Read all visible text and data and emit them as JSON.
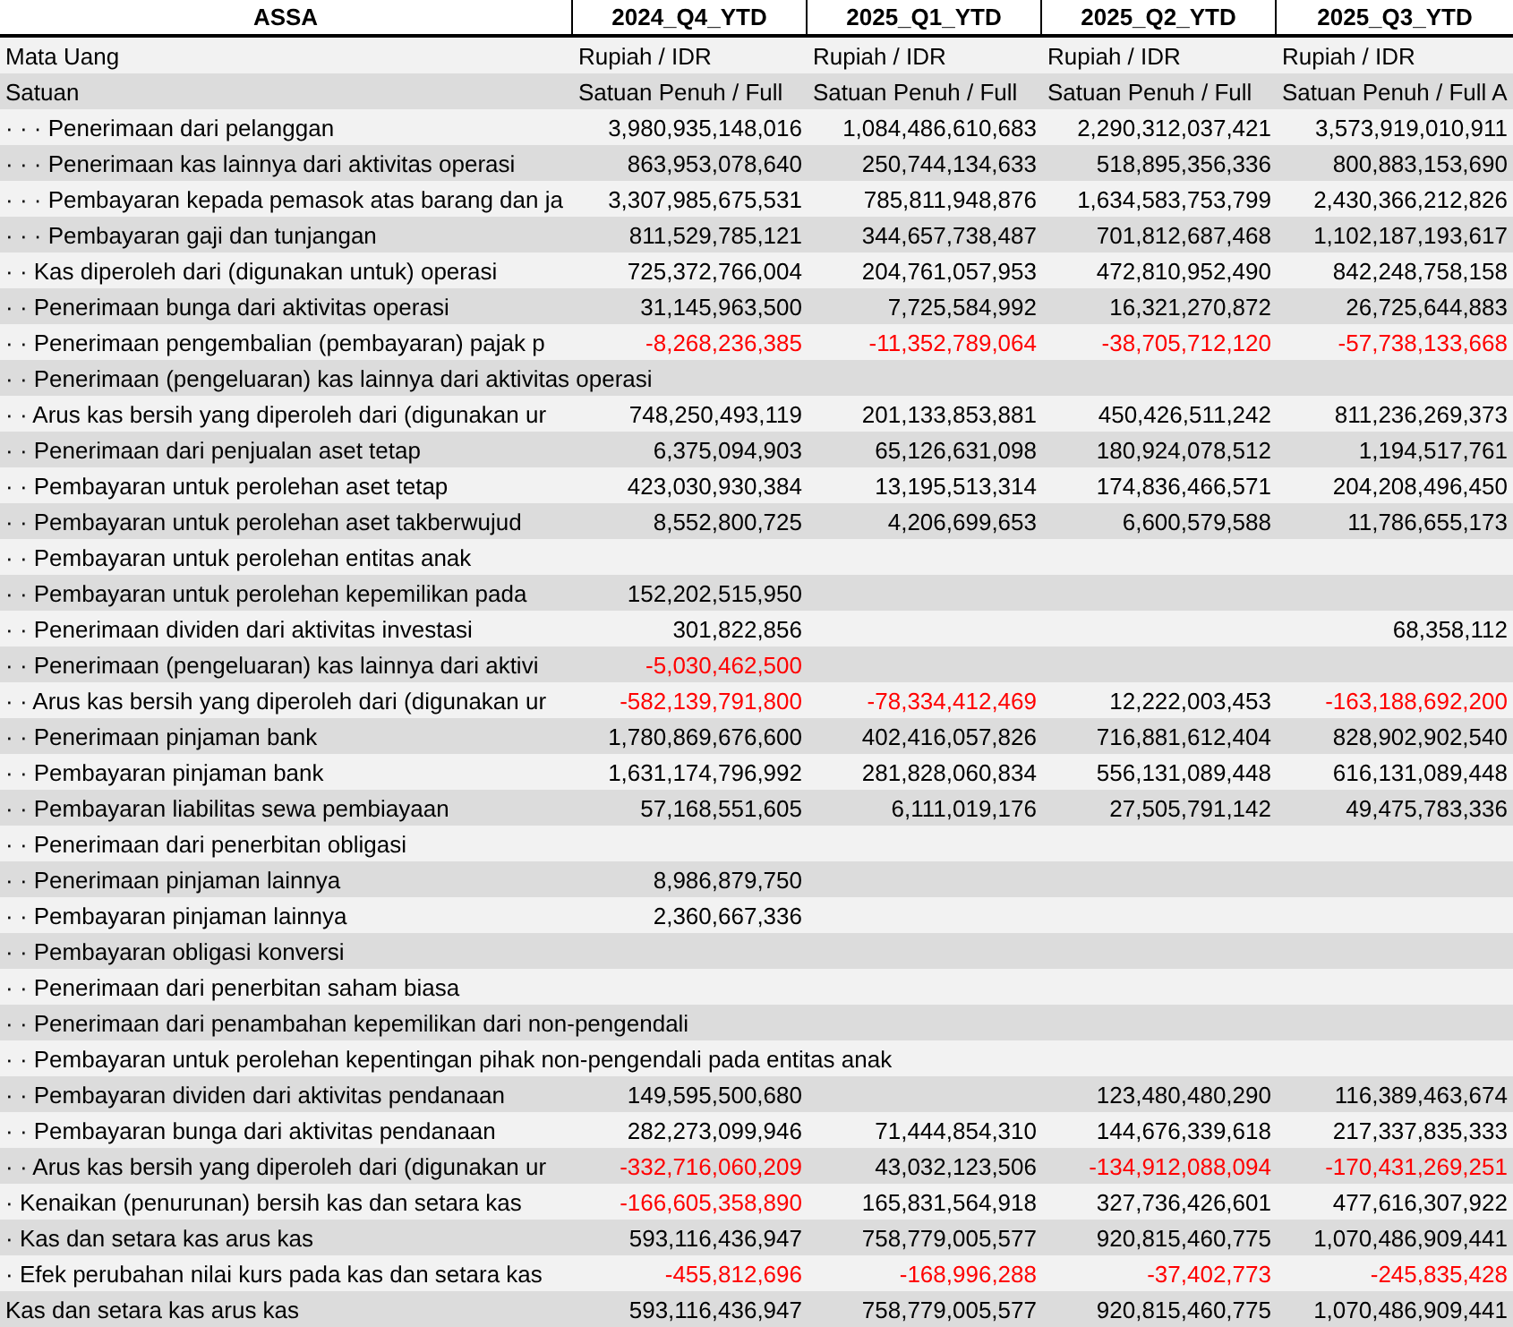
{
  "table": {
    "columns": [
      "ASSA",
      "2024_Q4_YTD",
      "2025_Q1_YTD",
      "2025_Q2_YTD",
      "2025_Q3_YTD"
    ],
    "rows": [
      {
        "kind": "meta",
        "label": "Mata Uang",
        "cells": {
          "q4_2024": {
            "text": "Rupiah / IDR",
            "negative": false
          },
          "q1_2025": {
            "text": "Rupiah / IDR",
            "negative": false
          },
          "q2_2025": {
            "text": "Rupiah / IDR",
            "negative": false
          },
          "q3_2025": {
            "text": "Rupiah / IDR",
            "negative": false
          }
        }
      },
      {
        "kind": "meta",
        "label": "Satuan",
        "cells": {
          "q4_2024": {
            "text": "Satuan Penuh / Full",
            "negative": false
          },
          "q1_2025": {
            "text": "Satuan Penuh / Full",
            "negative": false
          },
          "q2_2025": {
            "text": "Satuan Penuh / Full",
            "negative": false
          },
          "q3_2025": {
            "text": "Satuan Penuh / Full A",
            "negative": false
          }
        }
      },
      {
        "kind": "data",
        "label": "· · · Penerimaan dari pelanggan",
        "cells": {
          "q4_2024": {
            "text": "3,980,935,148,016",
            "negative": false
          },
          "q1_2025": {
            "text": "1,084,486,610,683",
            "negative": false
          },
          "q2_2025": {
            "text": "2,290,312,037,421",
            "negative": false
          },
          "q3_2025": {
            "text": "3,573,919,010,911",
            "negative": false
          }
        }
      },
      {
        "kind": "data",
        "label": "· · · Penerimaan kas lainnya dari aktivitas operasi",
        "cells": {
          "q4_2024": {
            "text": "863,953,078,640",
            "negative": false
          },
          "q1_2025": {
            "text": "250,744,134,633",
            "negative": false
          },
          "q2_2025": {
            "text": "518,895,356,336",
            "negative": false
          },
          "q3_2025": {
            "text": "800,883,153,690",
            "negative": false
          }
        }
      },
      {
        "kind": "data",
        "label": "· · · Pembayaran kepada pemasok atas barang dan ja",
        "cells": {
          "q4_2024": {
            "text": "3,307,985,675,531",
            "negative": false
          },
          "q1_2025": {
            "text": "785,811,948,876",
            "negative": false
          },
          "q2_2025": {
            "text": "1,634,583,753,799",
            "negative": false
          },
          "q3_2025": {
            "text": "2,430,366,212,826",
            "negative": false
          }
        }
      },
      {
        "kind": "data",
        "label": "· · · Pembayaran gaji dan tunjangan",
        "cells": {
          "q4_2024": {
            "text": "811,529,785,121",
            "negative": false
          },
          "q1_2025": {
            "text": "344,657,738,487",
            "negative": false
          },
          "q2_2025": {
            "text": "701,812,687,468",
            "negative": false
          },
          "q3_2025": {
            "text": "1,102,187,193,617",
            "negative": false
          }
        }
      },
      {
        "kind": "data",
        "label": "· · Kas diperoleh dari (digunakan untuk) operasi",
        "cells": {
          "q4_2024": {
            "text": "725,372,766,004",
            "negative": false
          },
          "q1_2025": {
            "text": "204,761,057,953",
            "negative": false
          },
          "q2_2025": {
            "text": "472,810,952,490",
            "negative": false
          },
          "q3_2025": {
            "text": "842,248,758,158",
            "negative": false
          }
        }
      },
      {
        "kind": "data",
        "label": "· · Penerimaan bunga dari aktivitas operasi",
        "cells": {
          "q4_2024": {
            "text": "31,145,963,500",
            "negative": false
          },
          "q1_2025": {
            "text": "7,725,584,992",
            "negative": false
          },
          "q2_2025": {
            "text": "16,321,270,872",
            "negative": false
          },
          "q3_2025": {
            "text": "26,725,644,883",
            "negative": false
          }
        }
      },
      {
        "kind": "data",
        "label": "· · Penerimaan pengembalian (pembayaran) pajak p",
        "cells": {
          "q4_2024": {
            "text": "-8,268,236,385",
            "negative": true
          },
          "q1_2025": {
            "text": "-11,352,789,064",
            "negative": true
          },
          "q2_2025": {
            "text": "-38,705,712,120",
            "negative": true
          },
          "q3_2025": {
            "text": "-57,738,133,668",
            "negative": true
          }
        }
      },
      {
        "kind": "data",
        "label": "· · Penerimaan (pengeluaran) kas lainnya dari aktivitas operasi"
      },
      {
        "kind": "data",
        "label": "· · Arus kas bersih yang diperoleh dari (digunakan ur",
        "cells": {
          "q4_2024": {
            "text": "748,250,493,119",
            "negative": false
          },
          "q1_2025": {
            "text": "201,133,853,881",
            "negative": false
          },
          "q2_2025": {
            "text": "450,426,511,242",
            "negative": false
          },
          "q3_2025": {
            "text": "811,236,269,373",
            "negative": false
          }
        }
      },
      {
        "kind": "data",
        "label": "· · Penerimaan dari penjualan aset tetap",
        "cells": {
          "q4_2024": {
            "text": "6,375,094,903",
            "negative": false
          },
          "q1_2025": {
            "text": "65,126,631,098",
            "negative": false
          },
          "q2_2025": {
            "text": "180,924,078,512",
            "negative": false
          },
          "q3_2025": {
            "text": "1,194,517,761",
            "negative": false
          }
        }
      },
      {
        "kind": "data",
        "label": "· · Pembayaran untuk perolehan aset tetap",
        "cells": {
          "q4_2024": {
            "text": "423,030,930,384",
            "negative": false
          },
          "q1_2025": {
            "text": "13,195,513,314",
            "negative": false
          },
          "q2_2025": {
            "text": "174,836,466,571",
            "negative": false
          },
          "q3_2025": {
            "text": "204,208,496,450",
            "negative": false
          }
        }
      },
      {
        "kind": "data",
        "label": "· · Pembayaran untuk perolehan aset takberwujud",
        "cells": {
          "q4_2024": {
            "text": "8,552,800,725",
            "negative": false
          },
          "q1_2025": {
            "text": "4,206,699,653",
            "negative": false
          },
          "q2_2025": {
            "text": "6,600,579,588",
            "negative": false
          },
          "q3_2025": {
            "text": "11,786,655,173",
            "negative": false
          }
        }
      },
      {
        "kind": "data",
        "label": "· · Pembayaran untuk perolehan entitas anak"
      },
      {
        "kind": "data",
        "label": "· · Pembayaran untuk perolehan kepemilikan pada",
        "cells": {
          "q4_2024": {
            "text": "152,202,515,950",
            "negative": false
          }
        }
      },
      {
        "kind": "data",
        "label": "· · Penerimaan dividen dari aktivitas investasi",
        "cells": {
          "q4_2024": {
            "text": "301,822,856",
            "negative": false
          },
          "q3_2025": {
            "text": "68,358,112",
            "negative": false
          }
        }
      },
      {
        "kind": "data",
        "label": "· · Penerimaan (pengeluaran) kas lainnya dari aktivi",
        "cells": {
          "q4_2024": {
            "text": "-5,030,462,500",
            "negative": true
          }
        }
      },
      {
        "kind": "data",
        "label": "· · Arus kas bersih yang diperoleh dari (digunakan ur",
        "cells": {
          "q4_2024": {
            "text": "-582,139,791,800",
            "negative": true
          },
          "q1_2025": {
            "text": "-78,334,412,469",
            "negative": true
          },
          "q2_2025": {
            "text": "12,222,003,453",
            "negative": false
          },
          "q3_2025": {
            "text": "-163,188,692,200",
            "negative": true
          }
        }
      },
      {
        "kind": "data",
        "label": "· · Penerimaan pinjaman bank",
        "cells": {
          "q4_2024": {
            "text": "1,780,869,676,600",
            "negative": false
          },
          "q1_2025": {
            "text": "402,416,057,826",
            "negative": false
          },
          "q2_2025": {
            "text": "716,881,612,404",
            "negative": false
          },
          "q3_2025": {
            "text": "828,902,902,540",
            "negative": false
          }
        }
      },
      {
        "kind": "data",
        "label": "· · Pembayaran pinjaman bank",
        "cells": {
          "q4_2024": {
            "text": "1,631,174,796,992",
            "negative": false
          },
          "q1_2025": {
            "text": "281,828,060,834",
            "negative": false
          },
          "q2_2025": {
            "text": "556,131,089,448",
            "negative": false
          },
          "q3_2025": {
            "text": "616,131,089,448",
            "negative": false
          }
        }
      },
      {
        "kind": "data",
        "label": "· · Pembayaran liabilitas sewa pembiayaan",
        "cells": {
          "q4_2024": {
            "text": "57,168,551,605",
            "negative": false
          },
          "q1_2025": {
            "text": "6,111,019,176",
            "negative": false
          },
          "q2_2025": {
            "text": "27,505,791,142",
            "negative": false
          },
          "q3_2025": {
            "text": "49,475,783,336",
            "negative": false
          }
        }
      },
      {
        "kind": "data",
        "label": "· · Penerimaan dari penerbitan obligasi"
      },
      {
        "kind": "data",
        "label": "· · Penerimaan pinjaman lainnya",
        "cells": {
          "q4_2024": {
            "text": "8,986,879,750",
            "negative": false
          }
        }
      },
      {
        "kind": "data",
        "label": "· · Pembayaran pinjaman lainnya",
        "cells": {
          "q4_2024": {
            "text": "2,360,667,336",
            "negative": false
          }
        }
      },
      {
        "kind": "data",
        "label": "· · Pembayaran obligasi konversi"
      },
      {
        "kind": "data",
        "label": "· · Penerimaan dari penerbitan saham biasa"
      },
      {
        "kind": "data",
        "label": "· · Penerimaan dari penambahan kepemilikan dari non-pengendali"
      },
      {
        "kind": "data",
        "label": "· · Pembayaran untuk perolehan kepentingan pihak non-pengendali pada entitas anak"
      },
      {
        "kind": "data",
        "label": "· · Pembayaran dividen dari aktivitas pendanaan",
        "cells": {
          "q4_2024": {
            "text": "149,595,500,680",
            "negative": false
          },
          "q2_2025": {
            "text": "123,480,480,290",
            "negative": false
          },
          "q3_2025": {
            "text": "116,389,463,674",
            "negative": false
          }
        }
      },
      {
        "kind": "data",
        "label": "· · Pembayaran bunga dari aktivitas pendanaan",
        "cells": {
          "q4_2024": {
            "text": "282,273,099,946",
            "negative": false
          },
          "q1_2025": {
            "text": "71,444,854,310",
            "negative": false
          },
          "q2_2025": {
            "text": "144,676,339,618",
            "negative": false
          },
          "q3_2025": {
            "text": "217,337,835,333",
            "negative": false
          }
        }
      },
      {
        "kind": "data",
        "label": "· · Arus kas bersih yang diperoleh dari (digunakan ur",
        "cells": {
          "q4_2024": {
            "text": "-332,716,060,209",
            "negative": true
          },
          "q1_2025": {
            "text": "43,032,123,506",
            "negative": false
          },
          "q2_2025": {
            "text": "-134,912,088,094",
            "negative": true
          },
          "q3_2025": {
            "text": "-170,431,269,251",
            "negative": true
          }
        }
      },
      {
        "kind": "data",
        "label": "· Kenaikan (penurunan) bersih kas dan setara kas",
        "cells": {
          "q4_2024": {
            "text": "-166,605,358,890",
            "negative": true
          },
          "q1_2025": {
            "text": "165,831,564,918",
            "negative": false
          },
          "q2_2025": {
            "text": "327,736,426,601",
            "negative": false
          },
          "q3_2025": {
            "text": "477,616,307,922",
            "negative": false
          }
        }
      },
      {
        "kind": "data",
        "label": "· Kas dan setara kas arus kas",
        "cells": {
          "q4_2024": {
            "text": "593,116,436,947",
            "negative": false
          },
          "q1_2025": {
            "text": "758,779,005,577",
            "negative": false
          },
          "q2_2025": {
            "text": "920,815,460,775",
            "negative": false
          },
          "q3_2025": {
            "text": "1,070,486,909,441",
            "negative": false
          }
        }
      },
      {
        "kind": "data",
        "label": "· Efek perubahan nilai kurs pada kas dan setara kas",
        "cells": {
          "q4_2024": {
            "text": "-455,812,696",
            "negative": true
          },
          "q1_2025": {
            "text": "-168,996,288",
            "negative": true
          },
          "q2_2025": {
            "text": "-37,402,773",
            "negative": true
          },
          "q3_2025": {
            "text": "-245,835,428",
            "negative": true
          }
        }
      },
      {
        "kind": "data",
        "label": "Kas dan setara kas arus kas",
        "cells": {
          "q4_2024": {
            "text": "593,116,436,947",
            "negative": false
          },
          "q1_2025": {
            "text": "758,779,005,577",
            "negative": false
          },
          "q2_2025": {
            "text": "920,815,460,775",
            "negative": false
          },
          "q3_2025": {
            "text": "1,070,486,909,441",
            "negative": false
          }
        }
      }
    ]
  }
}
